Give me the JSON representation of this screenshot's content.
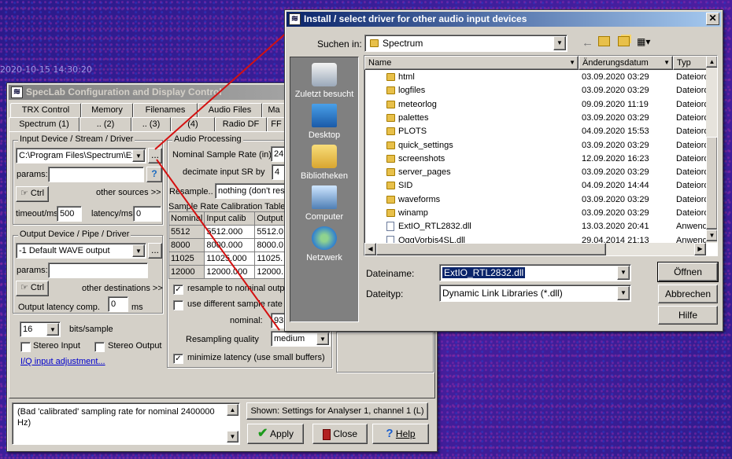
{
  "desktop": {
    "timestamp": "2020-10-15 14:30:20"
  },
  "config": {
    "title": "SpecLab  Configuration and Display Control",
    "tabs_row1": [
      "TRX Control",
      "Memory",
      "Filenames",
      "Audio Files",
      "Ma"
    ],
    "tabs_row2": [
      "Spectrum (1)",
      ".. (2)",
      ".. (3)",
      "(4)",
      "Radio DF",
      "FF"
    ],
    "input_group": {
      "label": "Input Device / Stream / Driver",
      "device": "C:\\Program Files\\Spectrum\\Extl",
      "browse": "...",
      "params_label": "params:",
      "params_value": "",
      "ctrl": "Ctrl",
      "other_sources": "other sources >>",
      "timeout_label": "timeout/ms",
      "timeout_value": "500",
      "latency_label": "latency/ms",
      "latency_value": "0"
    },
    "output_group": {
      "label": "Output Device / Pipe / Driver",
      "device": "-1 Default WAVE output",
      "browse": "...",
      "params_label": "params:",
      "ctrl": "Ctrl",
      "other_destinations": "other destinations >>",
      "latency_label": "Output latency comp.",
      "latency_value": "0",
      "latency_unit": "ms"
    },
    "bits_value": "16",
    "bits_label": "bits/sample",
    "stereo_input": "Stereo Input",
    "stereo_output": "Stereo Output",
    "iq_link": "I/Q input adjustment...",
    "audio_processing": {
      "label": "Audio Processing",
      "nominal_rate_label": "Nominal Sample Rate (in)",
      "nominal_rate_value": "24",
      "decimate_label": "decimate input SR by",
      "decimate_value": "4",
      "resample_label": "Resample..",
      "resample_value": "nothing (don't res",
      "cal_table_label": "Sample Rate Calibration Table",
      "cal_headers": [
        "Nominal",
        "Input calib",
        "Output"
      ],
      "cal_rows": [
        [
          "5512",
          "5512.000",
          "5512.0"
        ],
        [
          "8000",
          "8000.000",
          "8000.0"
        ],
        [
          "11025",
          "11025.000",
          "11025."
        ],
        [
          "12000",
          "12000.000",
          "12000."
        ]
      ],
      "resample_nominal": "resample to nominal outpu",
      "use_different": "use different sample rate",
      "nominal_label": "nominal:",
      "nominal_value": "93",
      "quality_label": "Resampling quality",
      "quality_value": "medium",
      "minimize_latency": "minimize latency (use small buffers)"
    },
    "status_text": "(Bad 'calibrated' sampling rate for nominal 2400000 Hz)",
    "shown_button": "Shown: Settings for Analyser 1, channel 1 (L)",
    "apply": "Apply",
    "close": "Close",
    "help": "Help"
  },
  "dialog": {
    "title": "Install / select driver for other audio input devices",
    "close": "✕",
    "look_in_label": "Suchen in:",
    "look_in_value": "Spectrum",
    "places": [
      "Zuletzt besucht",
      "Desktop",
      "Bibliotheken",
      "Computer",
      "Netzwerk"
    ],
    "columns": [
      "Name",
      "Änderungsdatum",
      "Typ"
    ],
    "files": [
      {
        "name": "html",
        "date": "03.09.2020 03:29",
        "type": "Dateiord",
        "kind": "folder"
      },
      {
        "name": "logfiles",
        "date": "03.09.2020 03:29",
        "type": "Dateiord",
        "kind": "folder"
      },
      {
        "name": "meteorlog",
        "date": "09.09.2020 11:19",
        "type": "Dateiord",
        "kind": "folder"
      },
      {
        "name": "palettes",
        "date": "03.09.2020 03:29",
        "type": "Dateiord",
        "kind": "folder"
      },
      {
        "name": "PLOTS",
        "date": "04.09.2020 15:53",
        "type": "Dateiord",
        "kind": "folder"
      },
      {
        "name": "quick_settings",
        "date": "03.09.2020 03:29",
        "type": "Dateiord",
        "kind": "folder"
      },
      {
        "name": "screenshots",
        "date": "12.09.2020 16:23",
        "type": "Dateiord",
        "kind": "folder"
      },
      {
        "name": "server_pages",
        "date": "03.09.2020 03:29",
        "type": "Dateiord",
        "kind": "folder"
      },
      {
        "name": "SID",
        "date": "04.09.2020 14:44",
        "type": "Dateiord",
        "kind": "folder"
      },
      {
        "name": "waveforms",
        "date": "03.09.2020 03:29",
        "type": "Dateiord",
        "kind": "folder"
      },
      {
        "name": "winamp",
        "date": "03.09.2020 03:29",
        "type": "Dateiord",
        "kind": "folder"
      },
      {
        "name": "ExtIO_RTL2832.dll",
        "date": "13.03.2020 20:41",
        "type": "Anwend",
        "kind": "dll"
      },
      {
        "name": "OggVorbis4SL.dll",
        "date": "29.04.2014 21:13",
        "type": "Anwend",
        "kind": "dll"
      }
    ],
    "filename_label": "Dateiname:",
    "filename_value": "ExtIO_RTL2832.dll",
    "filetype_label": "Dateityp:",
    "filetype_value": "Dynamic Link Libraries (*.dll)",
    "open": "Öffnen",
    "cancel": "Abbrechen",
    "help": "Hilfe"
  }
}
